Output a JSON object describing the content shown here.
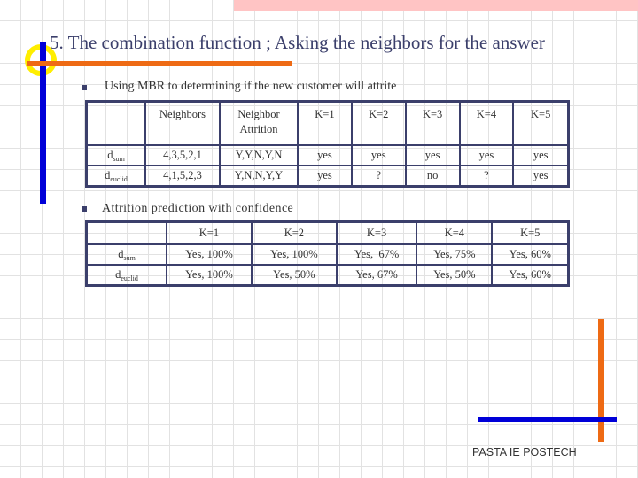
{
  "slide": {
    "title": "5. The combination function ; Asking the neighbors for the answer",
    "bullets": [
      "Using MBR to determining if the new customer will attrite",
      "Attrition prediction with confidence"
    ],
    "footer": "PASTA IE POSTECH",
    "colors": {
      "title_text": "#3b3f6b",
      "accent_blue": "#0000d8",
      "accent_orange": "#ee6a14",
      "accent_yellow": "#ffee00",
      "top_band_pink": "#ffc4c4",
      "table_border": "#3b3f6b"
    }
  },
  "table1": {
    "headers": [
      "",
      "Neighbors",
      "Neighbor Attrition",
      "K=1",
      "K=2",
      "K=3",
      "K=4",
      "K=5"
    ],
    "header_neighbor_attrition_line1": "Neighbor",
    "header_neighbor_attrition_line2": "Attrition",
    "rows": [
      {
        "label_main": "d",
        "label_sub": "sum",
        "cells": [
          "4,3,5,2,1",
          "Y,Y,N,Y,N",
          "yes",
          "yes",
          "yes",
          "yes",
          "yes"
        ]
      },
      {
        "label_main": "d",
        "label_sub": "euclid",
        "cells": [
          "4,1,5,2,3",
          "Y,N,N,Y,Y",
          "yes",
          "?",
          "no",
          "?",
          "yes"
        ]
      }
    ]
  },
  "table2": {
    "headers": [
      "",
      "K=1",
      "K=2",
      "K=3",
      "K=4",
      "K=5"
    ],
    "rows": [
      {
        "label_main": "d",
        "label_sub": "sum",
        "cells": [
          "Yes, 100%",
          "Yes, 100%",
          "Yes,  67%",
          "Yes, 75%",
          "Yes, 60%"
        ]
      },
      {
        "label_main": "d",
        "label_sub": "euclid",
        "cells": [
          "Yes, 100%",
          "Yes, 50%",
          "Yes, 67%",
          "Yes, 50%",
          "Yes, 60%"
        ]
      }
    ]
  }
}
